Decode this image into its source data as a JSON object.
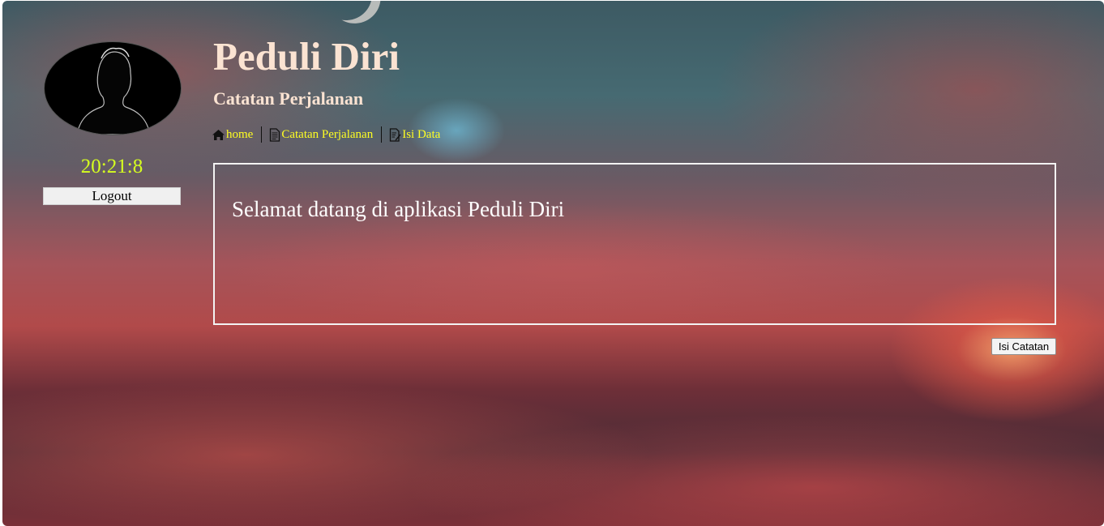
{
  "app": {
    "title": "Peduli Diri",
    "subtitle": "Catatan Perjalanan"
  },
  "sidebar": {
    "clock": "20:21:8",
    "logout_label": "Logout"
  },
  "nav": {
    "items": [
      {
        "label": "home",
        "icon": "home-icon"
      },
      {
        "label": "Catatan Perjalanan",
        "icon": "document-icon"
      },
      {
        "label": "Isi Data",
        "icon": "document-edit-icon"
      }
    ]
  },
  "main": {
    "welcome": "Selamat datang di aplikasi Peduli Diri",
    "isi_catatan_label": "Isi Catatan"
  },
  "colors": {
    "title": "#fbe3d2",
    "nav_link": "#ffff22",
    "clock": "#d6ff1f",
    "box_border": "#f3f3f3"
  }
}
